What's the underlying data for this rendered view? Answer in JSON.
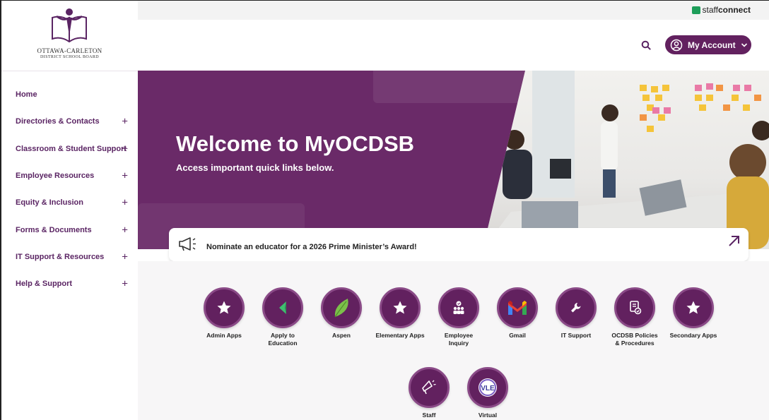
{
  "brand": {
    "org_line1": "OTTAWA-CARLETON",
    "org_line2": "DISTRICT SCHOOL BOARD",
    "provider_light": "staff",
    "provider_bold": "connect",
    "accent": "#62215f"
  },
  "sidebar": {
    "items": [
      {
        "label": "Home",
        "expandable": false
      },
      {
        "label": "Directories & Contacts",
        "expandable": true
      },
      {
        "label": "Classroom & Student Support",
        "expandable": true
      },
      {
        "label": "Employee Resources",
        "expandable": true
      },
      {
        "label": "Equity & Inclusion",
        "expandable": true
      },
      {
        "label": "Forms & Documents",
        "expandable": true
      },
      {
        "label": "IT Support & Resources",
        "expandable": true
      },
      {
        "label": "Help & Support",
        "expandable": true
      }
    ],
    "expand_glyph": "+"
  },
  "header": {
    "search_icon": "search-icon",
    "account_label": "My Account"
  },
  "hero": {
    "title": "Welcome to MyOCDSB",
    "subtitle": "Access important quick links below."
  },
  "announcement": {
    "text": "Nominate an educator for a 2026 Prime Minister’s Award!"
  },
  "apps": [
    {
      "label": "Admin Apps",
      "icon": "star-icon"
    },
    {
      "label": "Apply to Education",
      "icon": "send-icon"
    },
    {
      "label": "Aspen",
      "icon": "leaf-icon"
    },
    {
      "label": "Elementary Apps",
      "icon": "star-icon"
    },
    {
      "label": "Employee Inquiry",
      "icon": "people-icon"
    },
    {
      "label": "Gmail",
      "icon": "gmail-icon"
    },
    {
      "label": "IT Support",
      "icon": "wrench-icon"
    },
    {
      "label": "OCDSB Policies & Procedures",
      "icon": "policy-icon"
    },
    {
      "label": "Secondary Apps",
      "icon": "star-icon"
    },
    {
      "label": "Staff",
      "icon": "megaphone-icon"
    },
    {
      "label": "Virtual",
      "icon": "vle-icon"
    }
  ]
}
